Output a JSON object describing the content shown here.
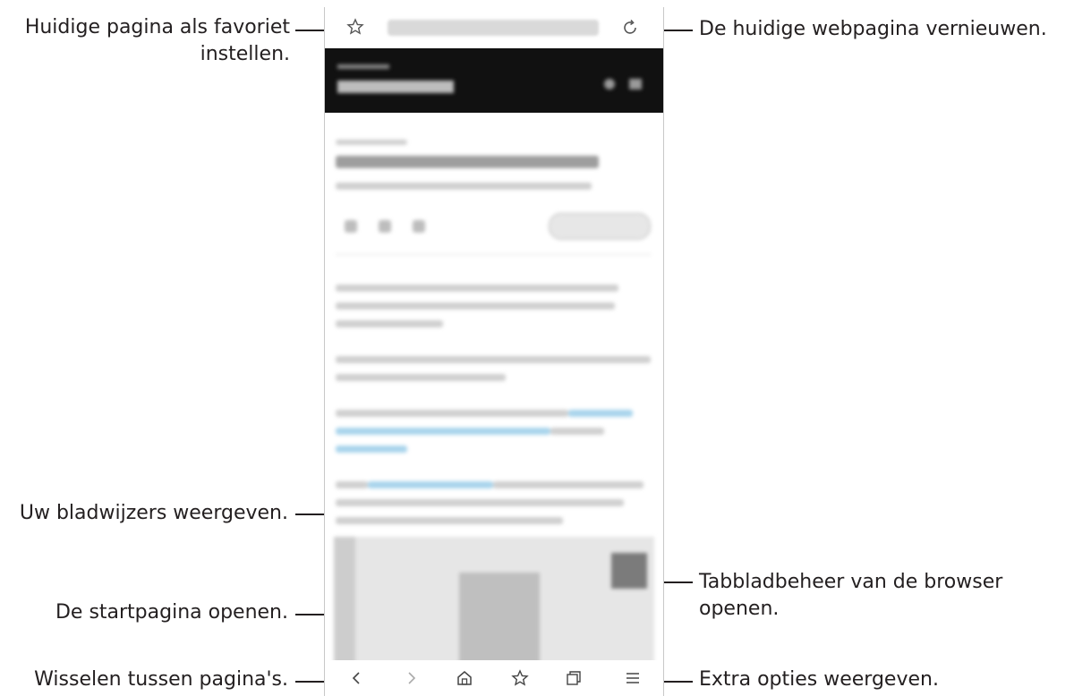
{
  "callouts": {
    "favorite_line1": "Huidige pagina als favoriet",
    "favorite_line2": "instellen.",
    "refresh": "De huidige webpagina vernieuwen.",
    "bookmarks": "Uw bladwijzers weergeven.",
    "home": "De startpagina openen.",
    "switch_pages": "Wisselen tussen pagina's.",
    "tabs_line1": "Tabbladbeheer van de browser",
    "tabs_line2": "openen.",
    "extra_options": "Extra opties weergeven."
  },
  "browser": {
    "icons": {
      "favorite": "star-icon",
      "refresh": "refresh-icon",
      "back": "chevron-left-icon",
      "forward": "chevron-right-icon",
      "home": "home-icon",
      "bookmarks": "star-icon",
      "tabs": "tabs-icon",
      "menu": "menu-icon"
    }
  }
}
